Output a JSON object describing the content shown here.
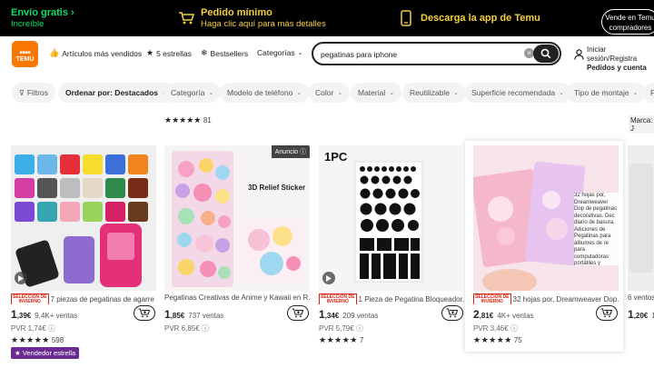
{
  "promo": {
    "envio_title": "Envío gratis",
    "envio_sub": "Increíble",
    "pedido_title": "Pedido mínimo",
    "pedido_sub": "Haga clic aquí para más detalles",
    "app_text": "Descarga la app de Temu",
    "vendor_line1": "Vende en Temu",
    "vendor_line2": "compradores"
  },
  "header": {
    "logo_text": "TEMU",
    "nav": [
      "Artículos más vendidos",
      "5 estrellas",
      "Bestsellers",
      "Categorías"
    ],
    "search_value": "pegatinas para iphone",
    "account_line1": "Iniciar sesión/Registra",
    "account_line2": "Pedidos y cuenta"
  },
  "filters": [
    "Filtros",
    "Ordenar por: Destacados",
    "Categoría",
    "Modelo de teléfono",
    "Color",
    "Material",
    "Reutilizable",
    "Superficie recomendada",
    "Tipo de montaje",
    "F"
  ],
  "rating_row": {
    "stars": "★★★★★",
    "count": "81"
  },
  "brand_tag": "Marca: J",
  "products": [
    {
      "title": "7 piezas de pegatinas de agarre ...",
      "winter_badge": true,
      "price_int": "1",
      "price_dec": ",39€",
      "sales": "9,4K+ ventas",
      "pvr": "PVR 1,74€",
      "stars": "★★★★★",
      "rating_count": "598",
      "star_seller": "Vendedor estrella",
      "video": true
    },
    {
      "title": "Pegatinas Creativas de Anime y Kawaii en R...",
      "winter_badge": false,
      "price_int": "1",
      "price_dec": ",85€",
      "sales": "737 ventas",
      "pvr": "PVR 6,85€",
      "stars": "",
      "rating_count": "",
      "ad_label": "Anuncio",
      "image_text": "3D Relief Sticker"
    },
    {
      "title": "1 Pieza de Pegatina Bloqueador...",
      "winter_badge": true,
      "price_int": "1",
      "price_dec": ",34€",
      "sales": "209 ventas",
      "pvr": "PVR 5,79€",
      "stars": "★★★★★",
      "rating_count": "7",
      "image_text": "1PC",
      "video": true
    },
    {
      "title": "32 hojas por, Dreamweaver Dop...",
      "winter_badge": true,
      "price_int": "2",
      "price_dec": ",81€",
      "sales": "4K+ ventas",
      "pvr": "PVR 3,46€",
      "stars": "★★★★★",
      "rating_count": "75",
      "image_caption": "32 hojas por, Dreamweaver Dop de pegatinas decorativas. Dec diario de basura, Adiciones de Pegatinas para álbumes de re para computadoras portátiles y teléfonos. Autoadhesivo, de"
    },
    {
      "title": "6 ventos",
      "winter_badge": false,
      "price_int": "1",
      "price_dec": ",20€",
      "sales": "1",
      "pvr": "",
      "stars": "",
      "rating_count": ""
    }
  ],
  "badge_text": "SELECCIÓN DE INVIERNO",
  "colors": {
    "accent": "#fb7701",
    "promo_green": "#0adc6a",
    "promo_yellow": "#f6d03c",
    "seller_purple": "#6b2c91"
  }
}
